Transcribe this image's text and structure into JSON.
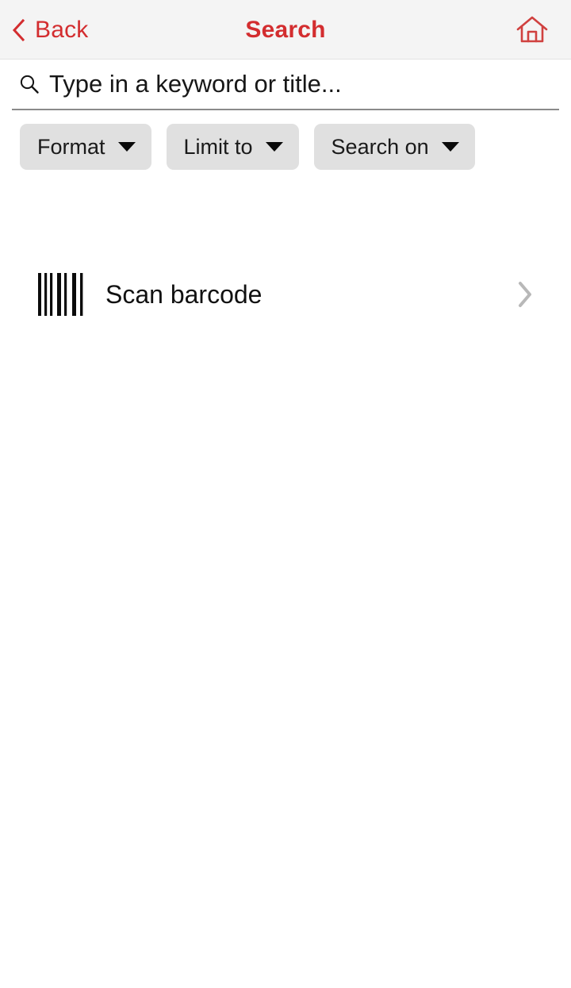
{
  "navbar": {
    "back_label": "Back",
    "back_icon": "chevron-left-icon",
    "title": "Search",
    "home_icon": "home-icon",
    "accent_color": "#d32d2f",
    "background_color": "#f4f4f4"
  },
  "search": {
    "icon": "search-icon",
    "value": "",
    "placeholder": "Type in a keyword or title..."
  },
  "filters": {
    "chips": [
      {
        "label": "Format",
        "icon": "chevron-down-icon"
      },
      {
        "label": "Limit to",
        "icon": "chevron-down-icon"
      },
      {
        "label": "Search on",
        "icon": "chevron-down-icon"
      }
    ],
    "chip_background": "#e0e0e0"
  },
  "actions": {
    "scan": {
      "label": "Scan barcode",
      "icon": "barcode-icon",
      "disclosure_icon": "chevron-right-icon",
      "disclosure_color": "#b8b8b8"
    }
  }
}
